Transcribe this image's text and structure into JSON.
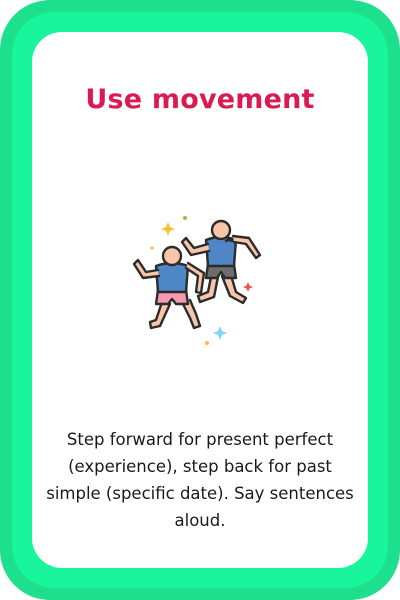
{
  "card": {
    "title": "Use movement",
    "icon": "dancing-people-icon",
    "description": "Step forward for present perfect (experience), step back for past simple (specific date). Say sentences aloud."
  },
  "colors": {
    "frame": "#19f59a",
    "card": "#ffffff",
    "title": "#dc1a52",
    "text": "#1a1a1a"
  }
}
